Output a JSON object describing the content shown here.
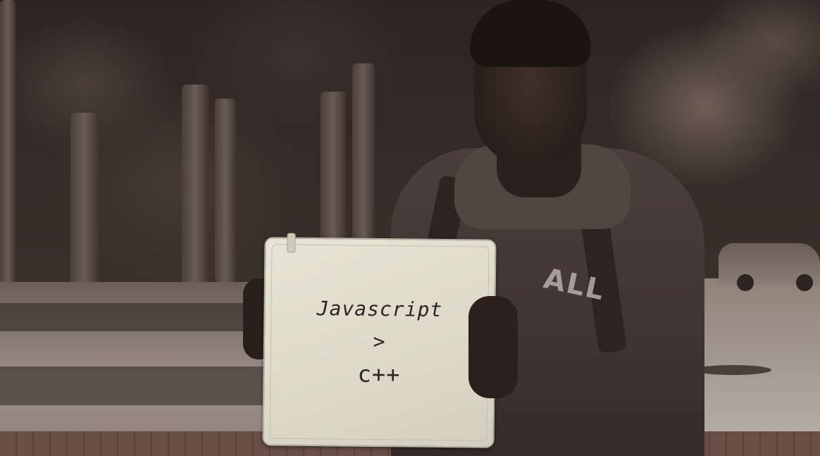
{
  "photo": {
    "board_text": {
      "line1": "Javascript",
      "line2": ">",
      "line3": "c++"
    },
    "shirt_text": "ALL"
  }
}
